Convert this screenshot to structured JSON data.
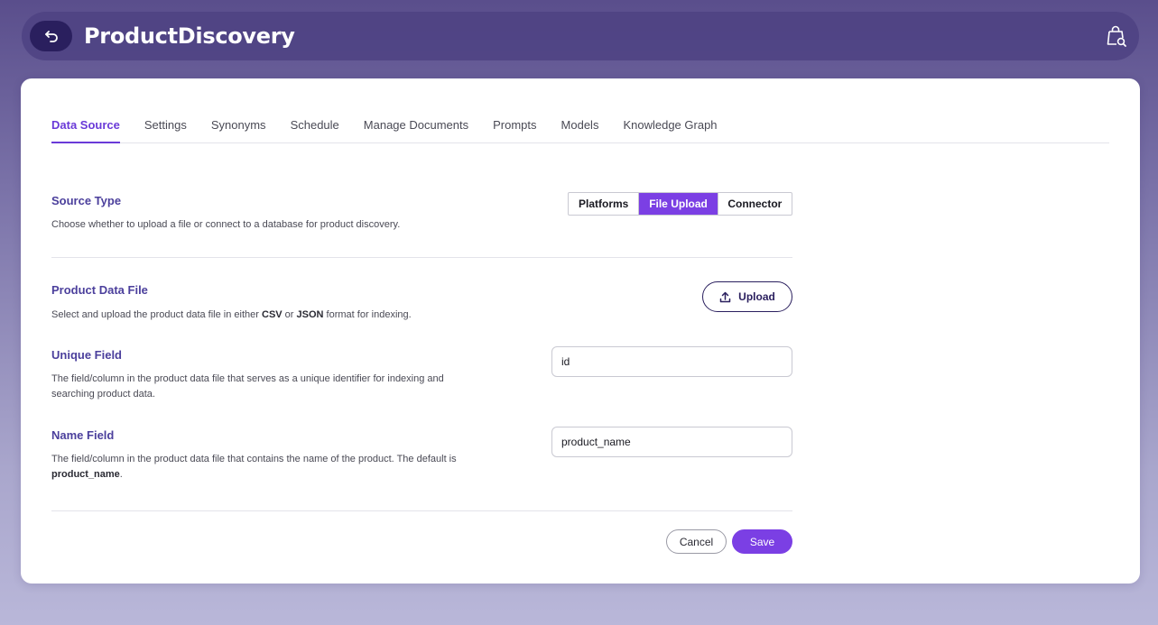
{
  "header": {
    "title": "ProductDiscovery",
    "back_icon": "back-arrow-icon",
    "action_icon": "shopping-bag-search-icon"
  },
  "tabs": [
    {
      "label": "Data Source",
      "active": true
    },
    {
      "label": "Settings"
    },
    {
      "label": "Synonyms"
    },
    {
      "label": "Schedule"
    },
    {
      "label": "Manage Documents"
    },
    {
      "label": "Prompts"
    },
    {
      "label": "Models"
    },
    {
      "label": "Knowledge Graph"
    }
  ],
  "source_type": {
    "title": "Source Type",
    "description": "Choose whether to upload a file or connect to a database for product discovery.",
    "options": [
      "Platforms",
      "File Upload",
      "Connector"
    ],
    "selected": "File Upload"
  },
  "product_file": {
    "title": "Product Data File",
    "desc_pre": "Select and upload the product data file in either ",
    "desc_csv": "CSV",
    "desc_or": " or ",
    "desc_json": "JSON",
    "desc_post": " format for indexing.",
    "upload_label": "Upload"
  },
  "unique_field": {
    "title": "Unique Field",
    "description": "The field/column in the product data file that serves as a unique identifier for indexing and searching product data.",
    "value": "id"
  },
  "name_field": {
    "title": "Name Field",
    "desc_pre": "The field/column in the product data file that contains the name of the product. The default is ",
    "desc_bold": "product_name",
    "desc_post": ".",
    "value": "product_name"
  },
  "actions": {
    "cancel_label": "Cancel",
    "save_label": "Save"
  },
  "colors": {
    "accent": "#7b3fe4",
    "dark_accent": "#2a1f5e",
    "section_title": "#4b3f9c"
  }
}
